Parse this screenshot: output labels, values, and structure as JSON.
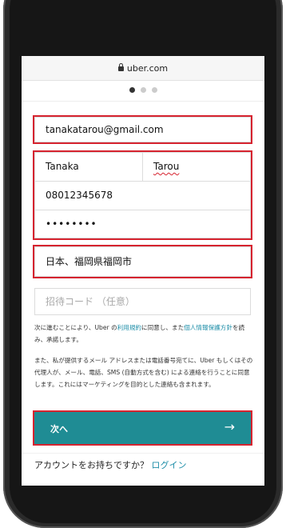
{
  "browser": {
    "url": "uber.com"
  },
  "pager": {
    "total": 3,
    "active": 0
  },
  "form": {
    "email": "tanakatarou@gmail.com",
    "last_name": "Tanaka",
    "first_name": "Tarou",
    "phone": "08012345678",
    "password": "••••••••",
    "address": "日本、福岡県福岡市",
    "invite_placeholder": "招待コード （任意）"
  },
  "terms": {
    "prefix": "次に進むことにより、Uber の",
    "terms_link": "利用規約",
    "mid": "に同意し、また",
    "privacy_link": "個人情報保護方針",
    "suffix": "を読み、承諾します。"
  },
  "consent": "また、私が提供するメール アドレスまたは電話番号宛てに、Uber もしくはその代理人が、メール、電話、SMS (自動方式を含む) による連絡を行うことに同意します。これにはマーケティングを目的とした連絡も含まれます。",
  "next_button": {
    "label": "次へ",
    "arrow": "→"
  },
  "login": {
    "prompt": "アカウントをお持ちですか？",
    "link": "ログイン"
  },
  "colors": {
    "accent": "#1f8c94",
    "link": "#1e8ea8",
    "highlight": "#d6232f"
  }
}
